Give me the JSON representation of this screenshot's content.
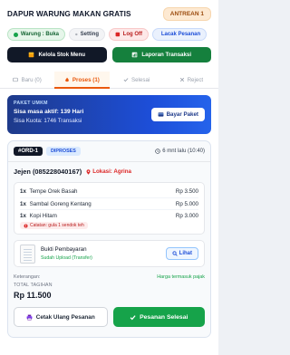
{
  "header": {
    "title": "DAPUR WARUNG MAKAN GRATIS",
    "queue_badge": "ANTREAN 1"
  },
  "chips": {
    "status": "Warung : Buka",
    "setting": "Setting",
    "logoff": "Log Off",
    "track": "Lacak Pesanan"
  },
  "actions": {
    "stock": "Kelola Stok Menu",
    "report": "Laporan Transaksi"
  },
  "tabs": [
    {
      "label": "Baru (0)",
      "active": false
    },
    {
      "label": "Proses (1)",
      "active": true
    },
    {
      "label": "Selesai",
      "active": false
    },
    {
      "label": "Reject",
      "active": false
    }
  ],
  "package": {
    "label": "PAKET UMKM",
    "active_period": "Sisa masa aktif: 139 Hari",
    "quota": "Sisa Kuota: 1746 Transaksi",
    "pay_button": "Bayar Paket"
  },
  "order": {
    "id": "#ORD-1",
    "status": "DIPROSES",
    "time": "6 mnt lalu (10:40)",
    "customer": "Jejen (085228040167)",
    "location": "Lokasi: Agrina",
    "items": [
      {
        "qty": "1x",
        "name": "Tempe Orek Basah",
        "price": "Rp 3.500"
      },
      {
        "qty": "1x",
        "name": "Sambal Goreng Kentang",
        "price": "Rp 5.000"
      },
      {
        "qty": "1x",
        "name": "Kopi Hitam",
        "price": "Rp 3.000"
      }
    ],
    "note": "Catatan: gula 1 sendok teh",
    "proof_title": "Bukti Pembayaran",
    "proof_status": "Sudah Upload (Transfer)",
    "view_button": "Lihat",
    "info_key": "Keterangan:",
    "info_value": "Harga termasuk pajak",
    "total_label": "TOTAL TAGIHAN",
    "total_value": "Rp 11.500",
    "reprint_button": "Cetak Ulang Pesanan",
    "finish_button": "Pesanan Selesai"
  }
}
